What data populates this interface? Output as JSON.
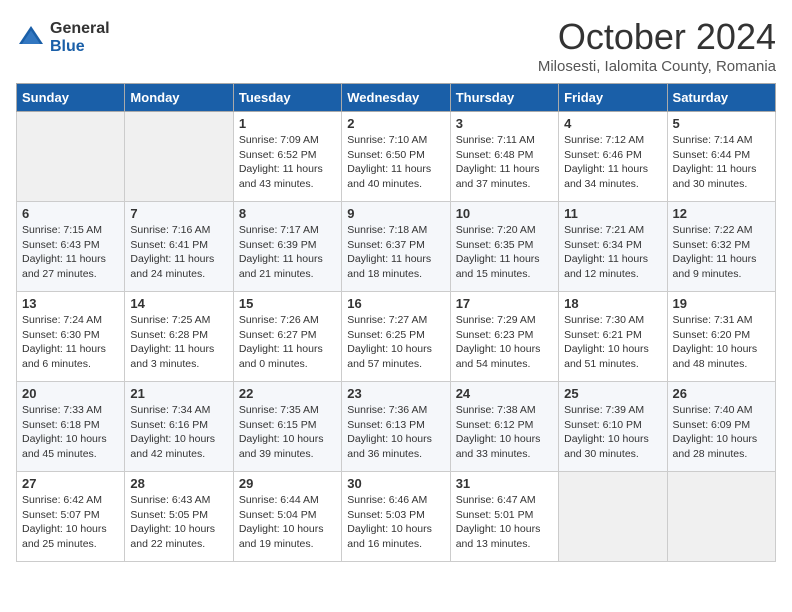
{
  "logo": {
    "general": "General",
    "blue": "Blue"
  },
  "title": "October 2024",
  "location": "Milosesti, Ialomita County, Romania",
  "days_of_week": [
    "Sunday",
    "Monday",
    "Tuesday",
    "Wednesday",
    "Thursday",
    "Friday",
    "Saturday"
  ],
  "weeks": [
    [
      {
        "day": "",
        "sunrise": "",
        "sunset": "",
        "daylight": ""
      },
      {
        "day": "",
        "sunrise": "",
        "sunset": "",
        "daylight": ""
      },
      {
        "day": "1",
        "sunrise": "Sunrise: 7:09 AM",
        "sunset": "Sunset: 6:52 PM",
        "daylight": "Daylight: 11 hours and 43 minutes."
      },
      {
        "day": "2",
        "sunrise": "Sunrise: 7:10 AM",
        "sunset": "Sunset: 6:50 PM",
        "daylight": "Daylight: 11 hours and 40 minutes."
      },
      {
        "day": "3",
        "sunrise": "Sunrise: 7:11 AM",
        "sunset": "Sunset: 6:48 PM",
        "daylight": "Daylight: 11 hours and 37 minutes."
      },
      {
        "day": "4",
        "sunrise": "Sunrise: 7:12 AM",
        "sunset": "Sunset: 6:46 PM",
        "daylight": "Daylight: 11 hours and 34 minutes."
      },
      {
        "day": "5",
        "sunrise": "Sunrise: 7:14 AM",
        "sunset": "Sunset: 6:44 PM",
        "daylight": "Daylight: 11 hours and 30 minutes."
      }
    ],
    [
      {
        "day": "6",
        "sunrise": "Sunrise: 7:15 AM",
        "sunset": "Sunset: 6:43 PM",
        "daylight": "Daylight: 11 hours and 27 minutes."
      },
      {
        "day": "7",
        "sunrise": "Sunrise: 7:16 AM",
        "sunset": "Sunset: 6:41 PM",
        "daylight": "Daylight: 11 hours and 24 minutes."
      },
      {
        "day": "8",
        "sunrise": "Sunrise: 7:17 AM",
        "sunset": "Sunset: 6:39 PM",
        "daylight": "Daylight: 11 hours and 21 minutes."
      },
      {
        "day": "9",
        "sunrise": "Sunrise: 7:18 AM",
        "sunset": "Sunset: 6:37 PM",
        "daylight": "Daylight: 11 hours and 18 minutes."
      },
      {
        "day": "10",
        "sunrise": "Sunrise: 7:20 AM",
        "sunset": "Sunset: 6:35 PM",
        "daylight": "Daylight: 11 hours and 15 minutes."
      },
      {
        "day": "11",
        "sunrise": "Sunrise: 7:21 AM",
        "sunset": "Sunset: 6:34 PM",
        "daylight": "Daylight: 11 hours and 12 minutes."
      },
      {
        "day": "12",
        "sunrise": "Sunrise: 7:22 AM",
        "sunset": "Sunset: 6:32 PM",
        "daylight": "Daylight: 11 hours and 9 minutes."
      }
    ],
    [
      {
        "day": "13",
        "sunrise": "Sunrise: 7:24 AM",
        "sunset": "Sunset: 6:30 PM",
        "daylight": "Daylight: 11 hours and 6 minutes."
      },
      {
        "day": "14",
        "sunrise": "Sunrise: 7:25 AM",
        "sunset": "Sunset: 6:28 PM",
        "daylight": "Daylight: 11 hours and 3 minutes."
      },
      {
        "day": "15",
        "sunrise": "Sunrise: 7:26 AM",
        "sunset": "Sunset: 6:27 PM",
        "daylight": "Daylight: 11 hours and 0 minutes."
      },
      {
        "day": "16",
        "sunrise": "Sunrise: 7:27 AM",
        "sunset": "Sunset: 6:25 PM",
        "daylight": "Daylight: 10 hours and 57 minutes."
      },
      {
        "day": "17",
        "sunrise": "Sunrise: 7:29 AM",
        "sunset": "Sunset: 6:23 PM",
        "daylight": "Daylight: 10 hours and 54 minutes."
      },
      {
        "day": "18",
        "sunrise": "Sunrise: 7:30 AM",
        "sunset": "Sunset: 6:21 PM",
        "daylight": "Daylight: 10 hours and 51 minutes."
      },
      {
        "day": "19",
        "sunrise": "Sunrise: 7:31 AM",
        "sunset": "Sunset: 6:20 PM",
        "daylight": "Daylight: 10 hours and 48 minutes."
      }
    ],
    [
      {
        "day": "20",
        "sunrise": "Sunrise: 7:33 AM",
        "sunset": "Sunset: 6:18 PM",
        "daylight": "Daylight: 10 hours and 45 minutes."
      },
      {
        "day": "21",
        "sunrise": "Sunrise: 7:34 AM",
        "sunset": "Sunset: 6:16 PM",
        "daylight": "Daylight: 10 hours and 42 minutes."
      },
      {
        "day": "22",
        "sunrise": "Sunrise: 7:35 AM",
        "sunset": "Sunset: 6:15 PM",
        "daylight": "Daylight: 10 hours and 39 minutes."
      },
      {
        "day": "23",
        "sunrise": "Sunrise: 7:36 AM",
        "sunset": "Sunset: 6:13 PM",
        "daylight": "Daylight: 10 hours and 36 minutes."
      },
      {
        "day": "24",
        "sunrise": "Sunrise: 7:38 AM",
        "sunset": "Sunset: 6:12 PM",
        "daylight": "Daylight: 10 hours and 33 minutes."
      },
      {
        "day": "25",
        "sunrise": "Sunrise: 7:39 AM",
        "sunset": "Sunset: 6:10 PM",
        "daylight": "Daylight: 10 hours and 30 minutes."
      },
      {
        "day": "26",
        "sunrise": "Sunrise: 7:40 AM",
        "sunset": "Sunset: 6:09 PM",
        "daylight": "Daylight: 10 hours and 28 minutes."
      }
    ],
    [
      {
        "day": "27",
        "sunrise": "Sunrise: 6:42 AM",
        "sunset": "Sunset: 5:07 PM",
        "daylight": "Daylight: 10 hours and 25 minutes."
      },
      {
        "day": "28",
        "sunrise": "Sunrise: 6:43 AM",
        "sunset": "Sunset: 5:05 PM",
        "daylight": "Daylight: 10 hours and 22 minutes."
      },
      {
        "day": "29",
        "sunrise": "Sunrise: 6:44 AM",
        "sunset": "Sunset: 5:04 PM",
        "daylight": "Daylight: 10 hours and 19 minutes."
      },
      {
        "day": "30",
        "sunrise": "Sunrise: 6:46 AM",
        "sunset": "Sunset: 5:03 PM",
        "daylight": "Daylight: 10 hours and 16 minutes."
      },
      {
        "day": "31",
        "sunrise": "Sunrise: 6:47 AM",
        "sunset": "Sunset: 5:01 PM",
        "daylight": "Daylight: 10 hours and 13 minutes."
      },
      {
        "day": "",
        "sunrise": "",
        "sunset": "",
        "daylight": ""
      },
      {
        "day": "",
        "sunrise": "",
        "sunset": "",
        "daylight": ""
      }
    ]
  ]
}
